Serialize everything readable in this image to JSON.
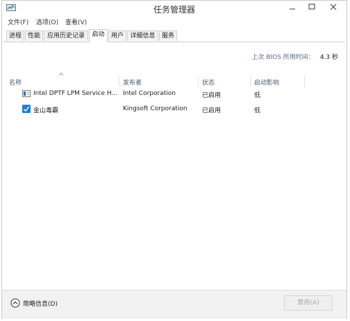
{
  "window": {
    "title": "任务管理器"
  },
  "menu": {
    "items": [
      "文件(F)",
      "选项(O)",
      "查看(V)"
    ]
  },
  "tabs": [
    "进程",
    "性能",
    "应用历史记录",
    "启动",
    "用户",
    "详细信息",
    "服务"
  ],
  "active_tab": "启动",
  "boot_time": {
    "label": "上次 BIOS 所用时间：",
    "value": "4.3 秒"
  },
  "columns": [
    "名称",
    "发布者",
    "状态",
    "启动影响"
  ],
  "rows": [
    {
      "name": "Intel DPTF LPM Service H...",
      "publisher": "Intel Corporation",
      "status": "已启用",
      "impact": "低",
      "icon": "service-app-icon"
    },
    {
      "name": "金山毒霸",
      "publisher": "Kingsoft Corporation",
      "status": "已启用",
      "impact": "低",
      "icon": "kingsoft-antivirus-icon"
    }
  ],
  "footer": {
    "collapse_label": "简略信息(D)",
    "end_task_label": "禁用(A)"
  }
}
